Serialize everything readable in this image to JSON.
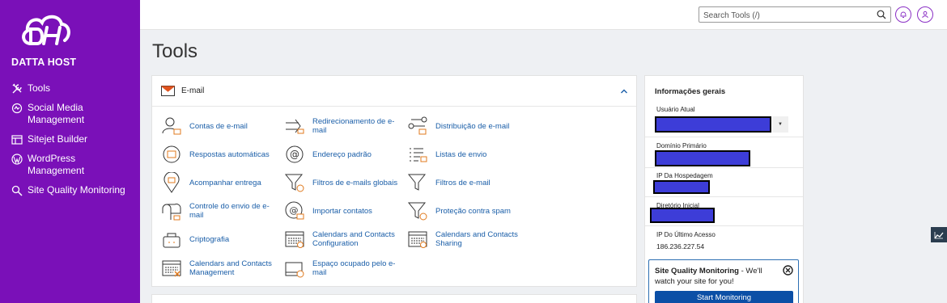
{
  "brand": {
    "name": "DATTA HOST",
    "logo_initials": "DH"
  },
  "sidebar": {
    "items": [
      {
        "label": "Tools",
        "icon": "tools-icon"
      },
      {
        "label": "Social Media Management",
        "icon": "social-icon"
      },
      {
        "label": "Sitejet Builder",
        "icon": "sitejet-icon"
      },
      {
        "label": "WordPress Management",
        "icon": "wordpress-icon"
      },
      {
        "label": "Site Quality Monitoring",
        "icon": "search-monitor-icon"
      }
    ]
  },
  "header": {
    "search_placeholder": "Search Tools (/)",
    "notifications_icon": "bell-icon",
    "user_icon": "user-icon"
  },
  "page": {
    "title": "Tools"
  },
  "email_panel": {
    "title": "E-mail",
    "tools": [
      {
        "label": "Contas de e-mail",
        "icon": "email-accounts-icon"
      },
      {
        "label": "Redirecionamento de e-mail",
        "icon": "forwarders-icon"
      },
      {
        "label": "Distribuição de e-mail",
        "icon": "email-routing-icon"
      },
      {
        "label": "Respostas automáticas",
        "icon": "autoresponders-icon"
      },
      {
        "label": "Endereço padrão",
        "icon": "default-address-icon"
      },
      {
        "label": "Listas de envio",
        "icon": "mailing-lists-icon"
      },
      {
        "label": "Acompanhar entrega",
        "icon": "track-delivery-icon"
      },
      {
        "label": "Filtros de e-mails globais",
        "icon": "global-filters-icon"
      },
      {
        "label": "Filtros de e-mail",
        "icon": "email-filters-icon"
      },
      {
        "label": "Controle do envio de e-mail",
        "icon": "email-deliverability-icon"
      },
      {
        "label": "Importar contatos",
        "icon": "import-contacts-icon"
      },
      {
        "label": "Proteção contra spam",
        "icon": "spam-protection-icon"
      },
      {
        "label": "Criptografia",
        "icon": "encryption-icon"
      },
      {
        "label": "Calendars and Contacts Configuration",
        "icon": "calendar-config-icon"
      },
      {
        "label": "Calendars and Contacts Sharing",
        "icon": "calendar-sharing-icon"
      },
      {
        "label": "Calendars and Contacts Management",
        "icon": "calendar-management-icon"
      },
      {
        "label": "Espaço ocupado pelo e-mail",
        "icon": "disk-usage-icon"
      }
    ]
  },
  "info": {
    "title": "Informações gerais",
    "current_user_label": "Usuário Atual",
    "primary_domain_label": "Domínio Primário",
    "shared_ip_label": "IP Da Hospedagem",
    "home_dir_label": "Diretório Inicial",
    "last_login_ip_label": "IP Do Último Acesso",
    "last_login_ip": "186.236.227.54"
  },
  "sqm_card": {
    "title": "Site Quality Monitoring",
    "body": " - We'll watch your site for you!",
    "button": "Start Monitoring"
  },
  "colors": {
    "sidebar": "#7a10b8",
    "link": "#1a5ea8",
    "button": "#0b4fa6",
    "accent_orange": "#e07a1e"
  }
}
